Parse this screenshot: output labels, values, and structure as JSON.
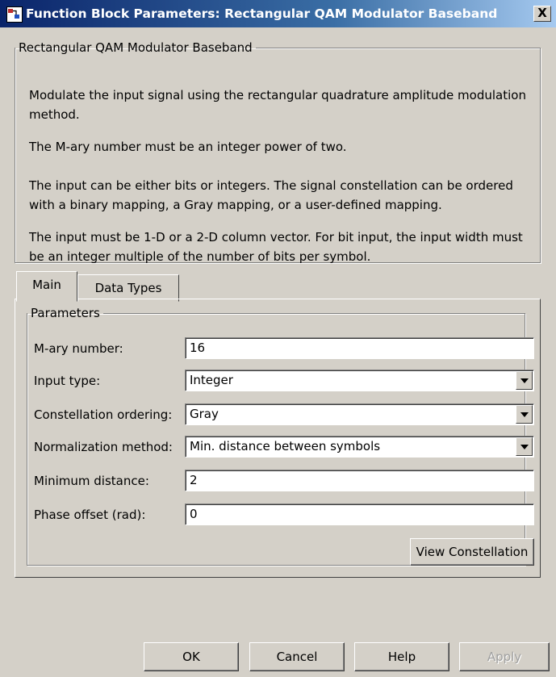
{
  "window": {
    "title": "Function Block Parameters: Rectangular QAM Modulator Baseband",
    "close_label": "X"
  },
  "description": {
    "legend": "Rectangular QAM Modulator Baseband",
    "lines": [
      "Modulate the input signal using the rectangular quadrature amplitude modulation",
      "method.",
      "The M-ary number must be an integer power of two.",
      "The input can be either bits or integers. The signal constellation can be ordered",
      "with a binary mapping, a Gray mapping, or a user-defined mapping.",
      "The input must be 1-D or a 2-D column vector. For bit input, the input width must",
      "be an integer multiple of the number of bits per symbol."
    ]
  },
  "tabs": [
    {
      "label": "Main",
      "active": true
    },
    {
      "label": "Data Types",
      "active": false
    }
  ],
  "parameters": {
    "legend": "Parameters",
    "mary_number": {
      "label": "M-ary number:",
      "value": "16"
    },
    "input_type": {
      "label": "Input type:",
      "value": "Integer"
    },
    "constellation_ordering": {
      "label": "Constellation ordering:",
      "value": "Gray"
    },
    "normalization_method": {
      "label": "Normalization method:",
      "value": "Min. distance between symbols"
    },
    "minimum_distance": {
      "label": "Minimum distance:",
      "value": "2"
    },
    "phase_offset": {
      "label": "Phase offset (rad):",
      "value": "0"
    },
    "view_constellation_label": "View Constellation"
  },
  "buttons": {
    "ok": "OK",
    "cancel": "Cancel",
    "help": "Help",
    "apply": "Apply"
  }
}
